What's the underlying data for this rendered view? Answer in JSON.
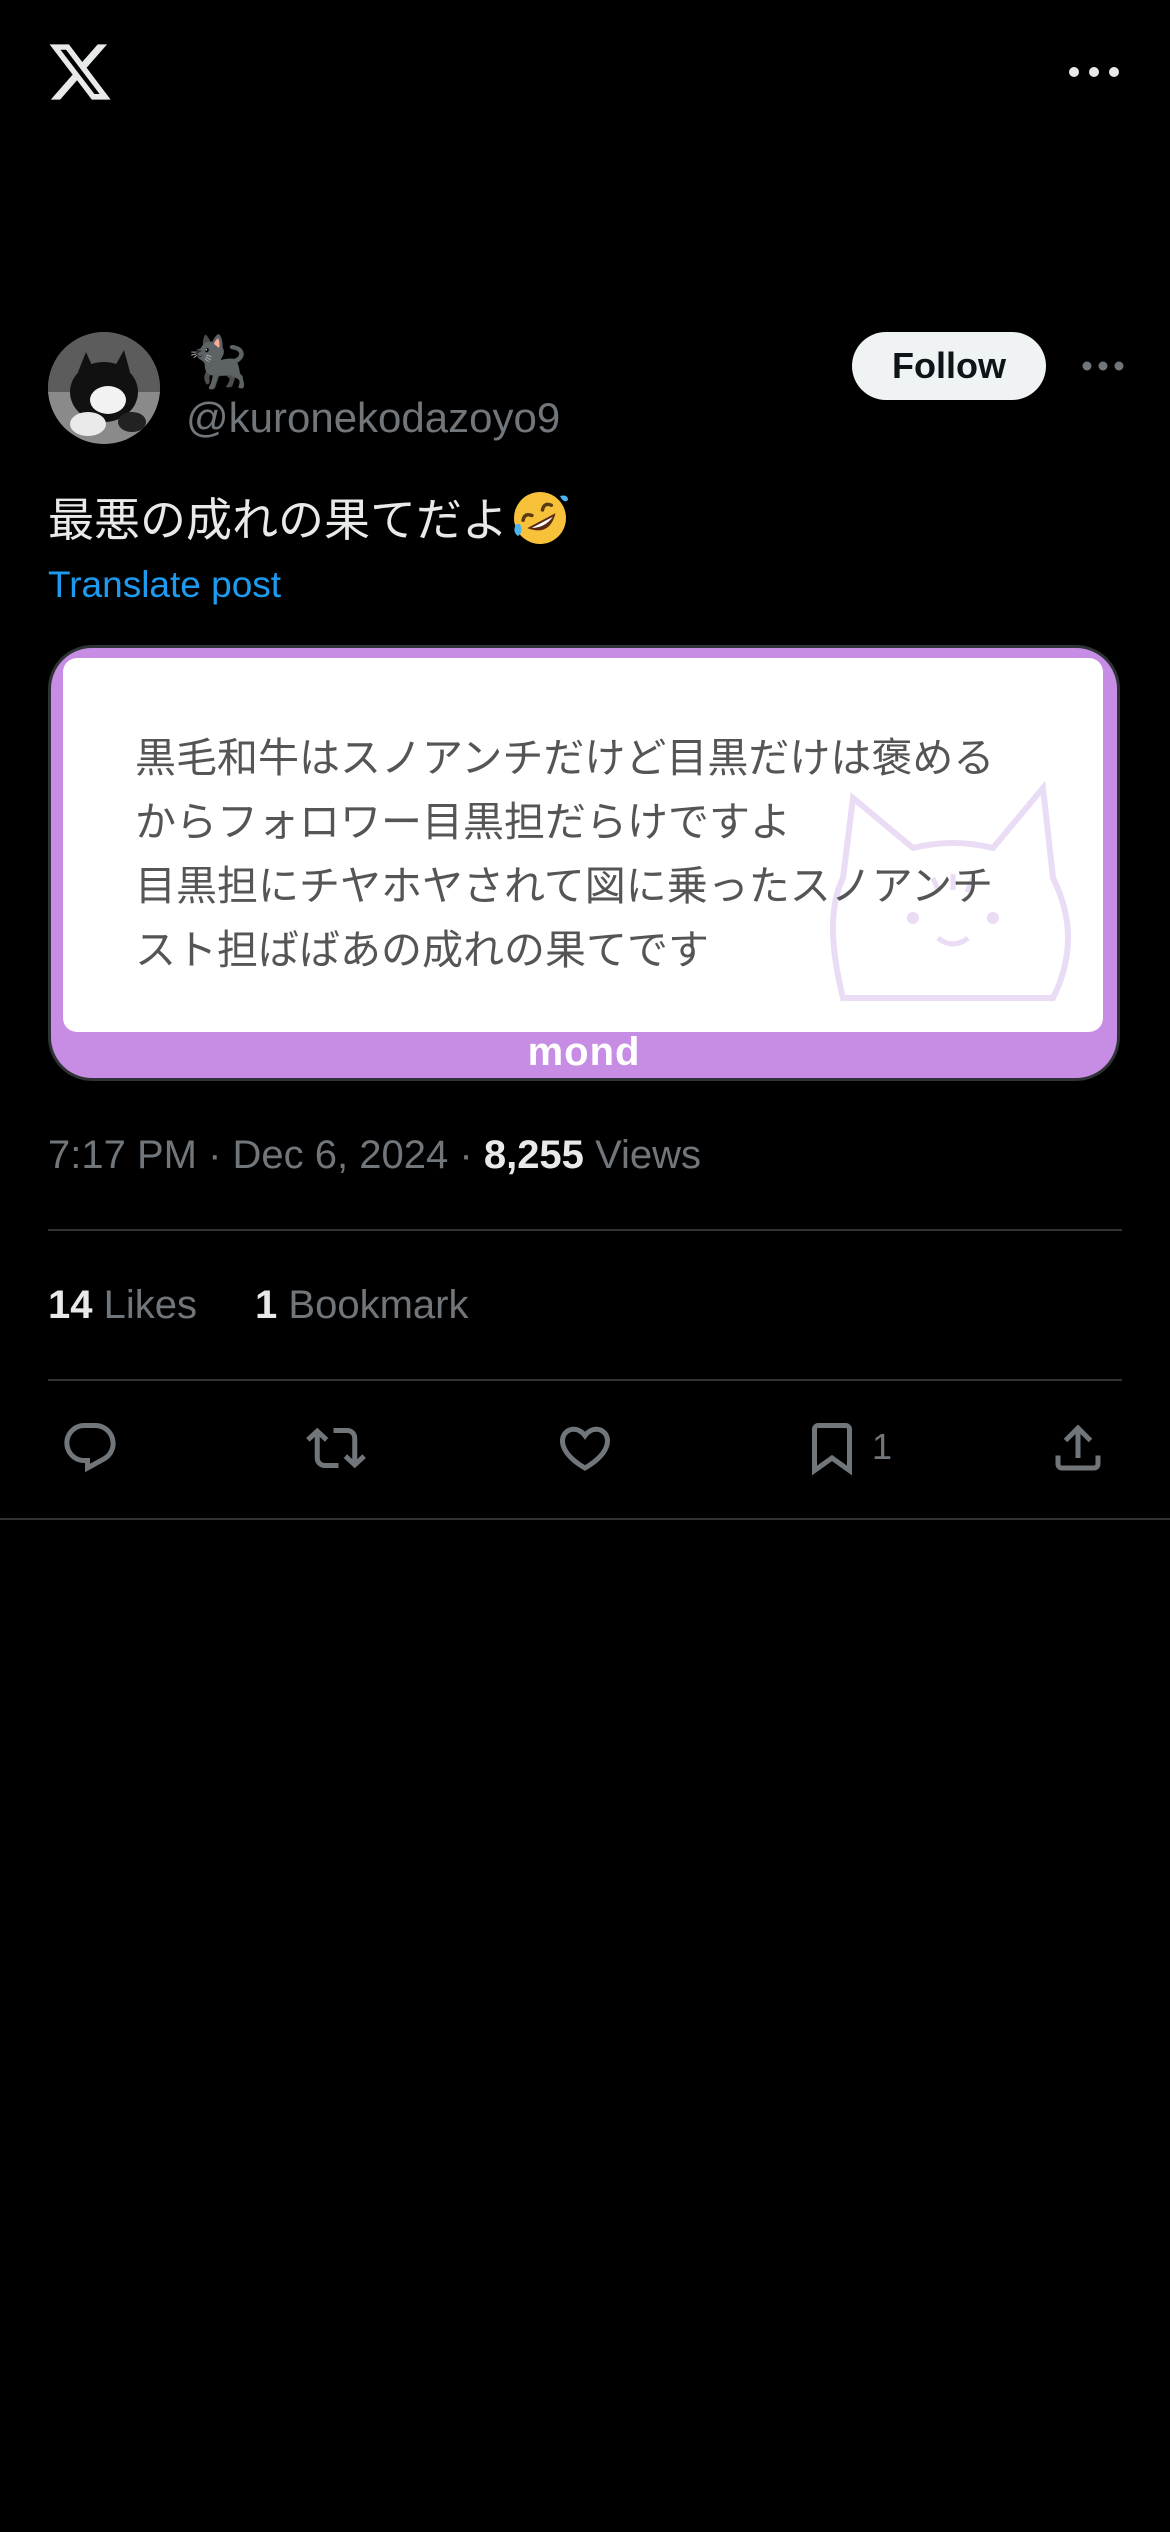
{
  "header": {
    "logo_icon": "x-logo-icon",
    "more_icon": "more-horizontal-icon"
  },
  "author": {
    "display_name": "🐈‍⬛",
    "handle": "@kuronekodazoyo9",
    "follow_label": "Follow",
    "more_icon": "more-horizontal-icon"
  },
  "post": {
    "text": "最悪の成れの果てだよ",
    "emoji": "rolling-on-floor-laughing",
    "translate_label": "Translate post",
    "media": {
      "text": "黒毛和牛はスノアンチだけど目黒だけは褒める\nからフォロワー目黒担だらけですよ\n目黒担にチヤホヤされて図に乗ったスノアンチ\nスト担ばばあの成れの果てです",
      "footer_brand": "mond",
      "accent_color": "#c78de4"
    }
  },
  "meta": {
    "time": "7:17 PM",
    "date": "Dec 6, 2024",
    "separator": "·",
    "views_count": "8,255",
    "views_label": "Views"
  },
  "stats": {
    "likes_count": "14",
    "likes_label": "Likes",
    "bookmarks_count": "1",
    "bookmarks_label": "Bookmark"
  },
  "actions": {
    "reply_icon": "reply-icon",
    "repost_icon": "repost-icon",
    "like_icon": "heart-icon",
    "bookmark_icon": "bookmark-icon",
    "bookmark_count": "1",
    "share_icon": "share-icon"
  },
  "colors": {
    "background": "#000000",
    "text": "#e7e9ea",
    "muted": "#71767b",
    "link": "#1d9bf0",
    "divider": "#2f3336"
  }
}
